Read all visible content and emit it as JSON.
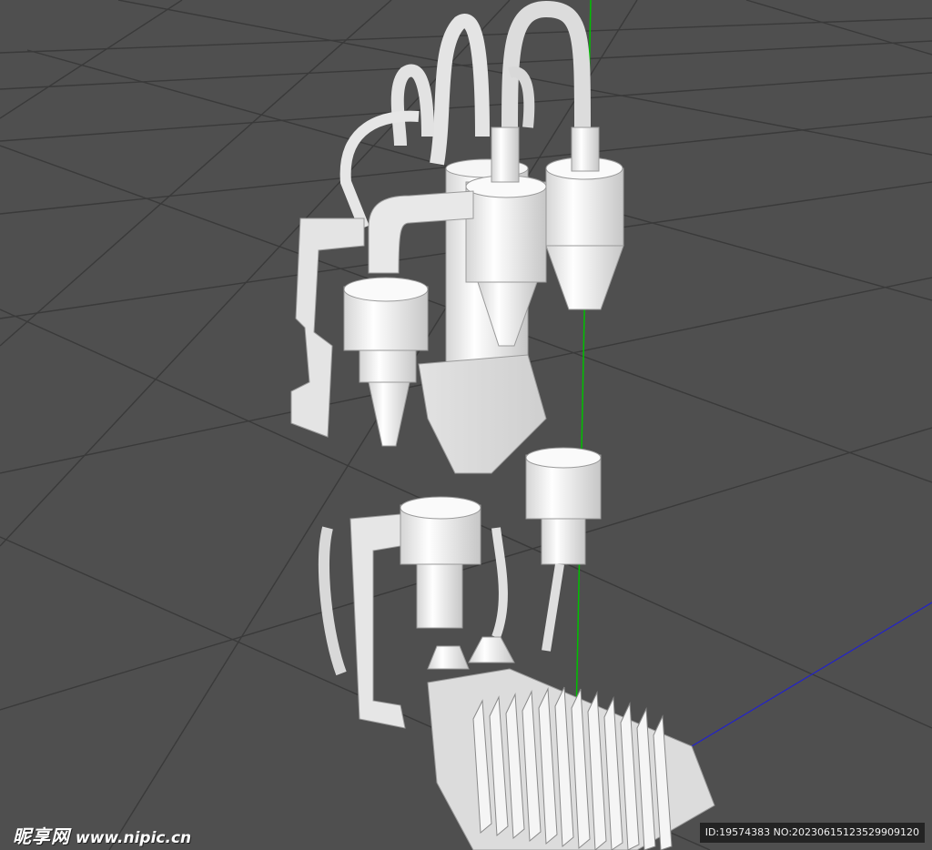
{
  "viewport": {
    "scene": "3d-viewport",
    "background_color": "#4f4f4f",
    "grid_color": "#3a3a3a",
    "model_color": "#f2f2f2",
    "axis_colors": {
      "y": "#00c000",
      "z": "#2222cc"
    }
  },
  "watermark": {
    "brand": "昵享网",
    "url": "www.nipic.cn",
    "id_text": "ID:19574383 NO:20230615123529909120"
  }
}
